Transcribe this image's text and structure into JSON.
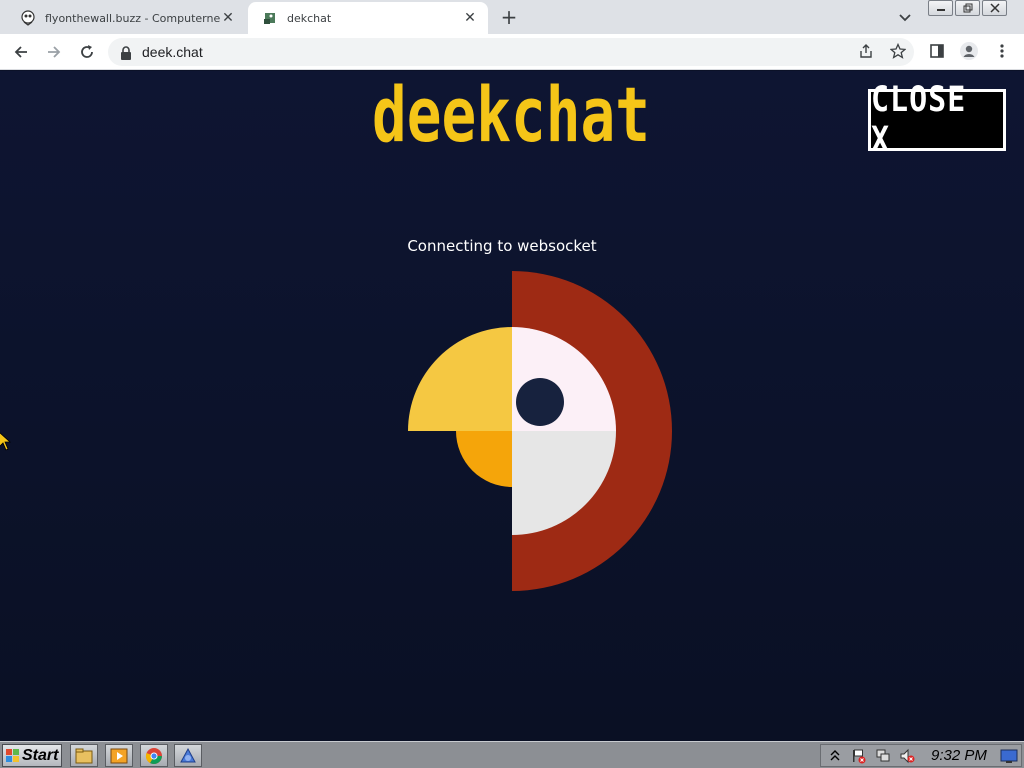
{
  "browser": {
    "tabs": [
      {
        "title": "flyonthewall.buzz - Computernewb",
        "active": false
      },
      {
        "title": "dekchat",
        "active": true
      }
    ],
    "new_tab_label": "+",
    "close_glyph": "✕",
    "address": {
      "url": "deek.chat"
    }
  },
  "page": {
    "logo_text": "deekchat",
    "close_button_label": "CLOSE X",
    "status_text": "Connecting to websocket"
  },
  "taskbar": {
    "start_label": "Start",
    "clock": "9:32 PM"
  },
  "colors": {
    "page_bg": "#0b1128",
    "logo_yellow": "#f5c518",
    "bird_red": "#9e2a14",
    "bird_beak_top": "#f5c842",
    "bird_beak_bottom": "#f5a50a",
    "bird_face_top": "#fcf0f7",
    "bird_face_bottom": "#e6e6e6",
    "bird_eye": "#17223e"
  },
  "icons": [
    "back-icon",
    "forward-icon",
    "reload-icon",
    "lock-icon",
    "share-icon",
    "star-icon",
    "side-panel-icon",
    "profile-icon",
    "menu-icon"
  ]
}
